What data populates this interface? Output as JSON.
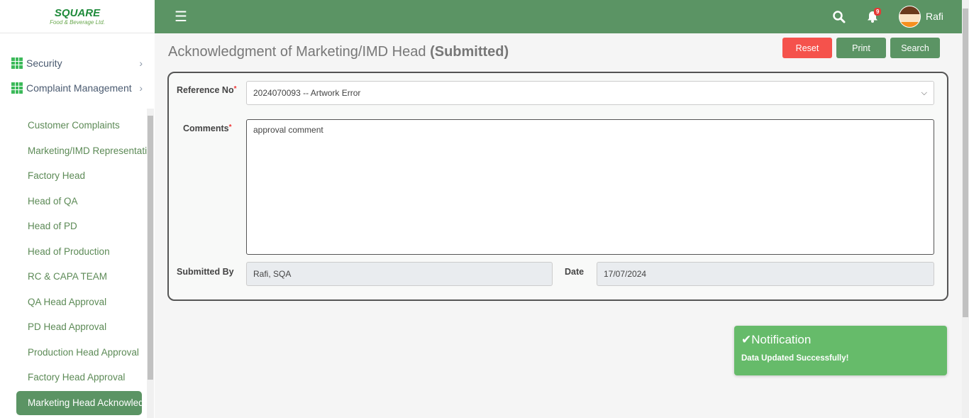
{
  "logo": {
    "line1": "SQUARE",
    "line2": "Food & Beverage Ltd."
  },
  "sidebar": {
    "sections": [
      {
        "label": "Security"
      },
      {
        "label": "Complaint Management"
      }
    ],
    "items": [
      "Customer Complaints",
      "Marketing/IMD Representative",
      "Factory Head",
      "Head of QA",
      "Head of PD",
      "Head of Production",
      "RC & CAPA TEAM",
      "QA Head Approval",
      "PD Head Approval",
      "Production Head Approval",
      "Factory Head Approval"
    ],
    "active": "Marketing Head Acknowledgment"
  },
  "header": {
    "notification_count": "9",
    "user": "Rafi"
  },
  "page": {
    "title": "Acknowledgment of Marketing/IMD Head",
    "status": "(Submitted)"
  },
  "buttons": {
    "reset": "Reset",
    "print": "Print",
    "search": "Search"
  },
  "form": {
    "reference_label": "Reference No",
    "reference_value": "2024070093 -- Artwork Error",
    "comments_label": "Comments",
    "comments_value": "approval comment",
    "submitted_by_label": "Submitted By",
    "submitted_by_value": "Rafi, SQA",
    "date_label": "Date",
    "date_value": "17/07/2024"
  },
  "notification": {
    "title": "Notification",
    "message": "Data Updated Successfully!"
  }
}
